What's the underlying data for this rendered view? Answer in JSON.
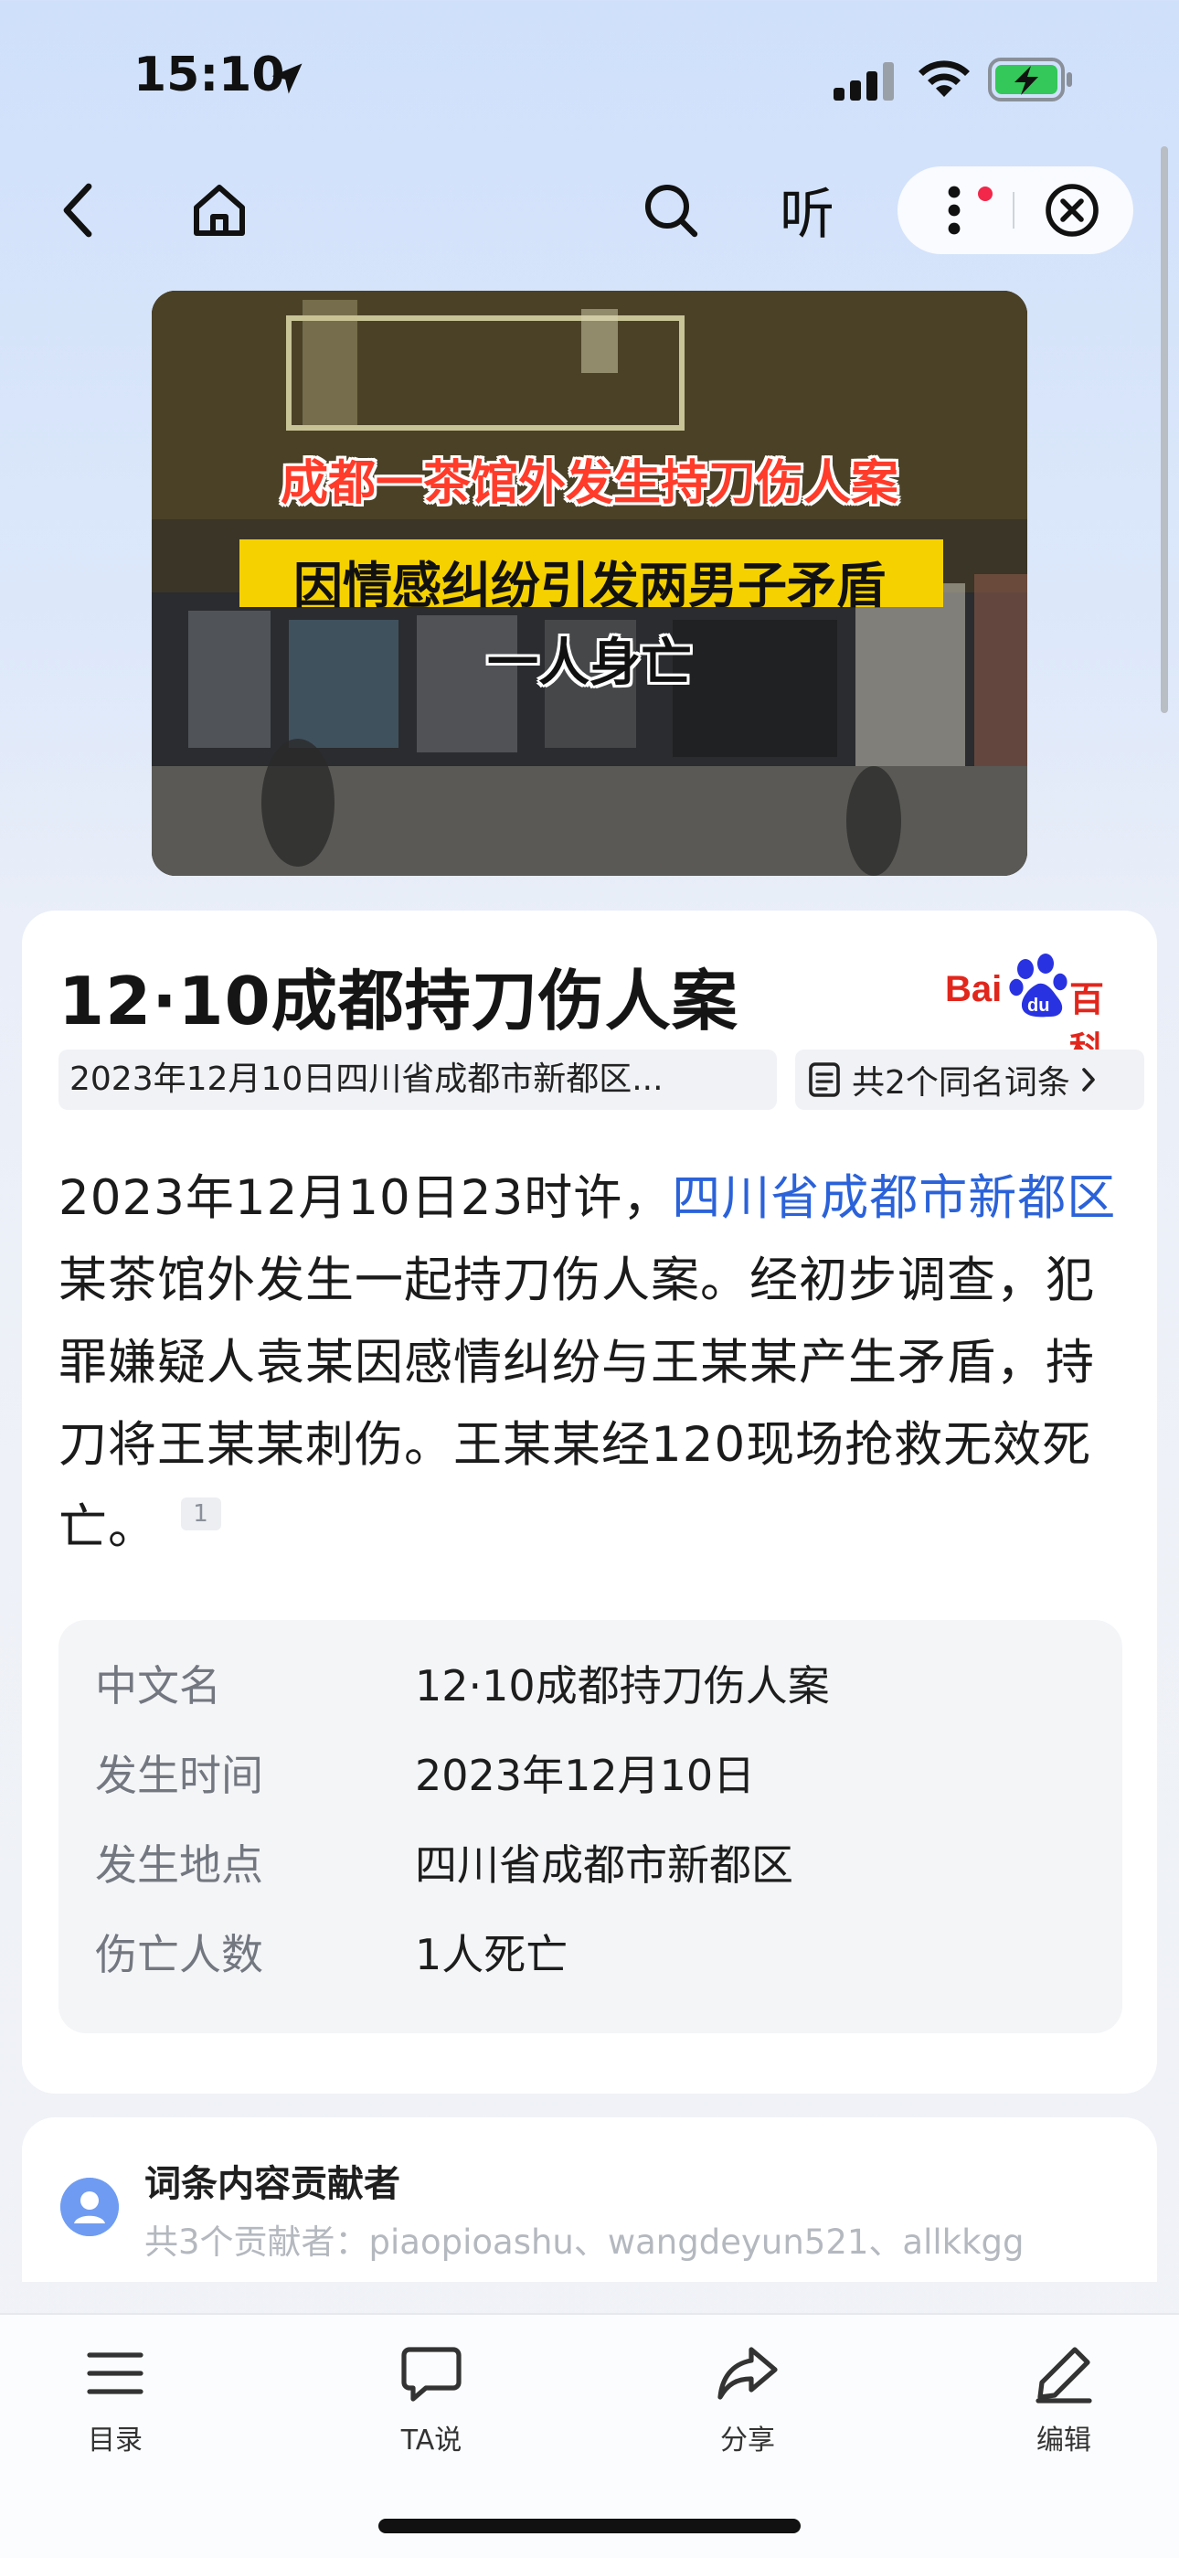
{
  "status_bar": {
    "time": "15:10",
    "icons": [
      "location-arrow-icon",
      "cellular-signal-icon",
      "wifi-icon",
      "battery-charging-icon"
    ]
  },
  "nav": {
    "back_icon": "chevron-left-icon",
    "home_icon": "home-icon",
    "search_icon": "search-icon",
    "listen_label": "听",
    "more_icon": "more-vertical-icon",
    "close_icon": "close-circle-icon",
    "notification_dot_color": "#f2274a"
  },
  "hero": {
    "line1": "成都一茶馆外发生持刀伤人案",
    "line2": "因情感纠纷引发两男子矛盾",
    "line3": "一人身亡"
  },
  "entry": {
    "title": "12·10成都持刀伤人案",
    "logo_text_bai": "Bai",
    "logo_text_du": "du",
    "logo_text_baike": "百科",
    "subtitle": "2023年12月10日四川省成都市新都区...",
    "homonym_label": "共2个同名词条",
    "summary_part1": "2023年12月10日23时许，",
    "summary_link": "四川省成都市新都区",
    "summary_part2": "某茶馆外发生一起持刀伤人案。经初步调查，犯罪嫌疑人袁某因感情纠纷与王某某产生矛盾，持刀将王某某刺伤。王某某经120现场抢救无效死亡。",
    "ref_number": "1",
    "link_color": "#2b62d9"
  },
  "infobox": {
    "rows": [
      {
        "key": "中文名",
        "value": "12·10成都持刀伤人案"
      },
      {
        "key": "发生时间",
        "value": "2023年12月10日"
      },
      {
        "key": "发生地点",
        "value": "四川省成都市新都区"
      },
      {
        "key": "伤亡人数",
        "value": "1人死亡"
      }
    ]
  },
  "contributors": {
    "title": "词条内容贡献者",
    "names": "共3个贡献者：piaopioashu、wangdeyun521、allkkgg"
  },
  "toolbar": {
    "catalog": "目录",
    "ta": "TA说",
    "share": "分享",
    "edit": "编辑"
  }
}
